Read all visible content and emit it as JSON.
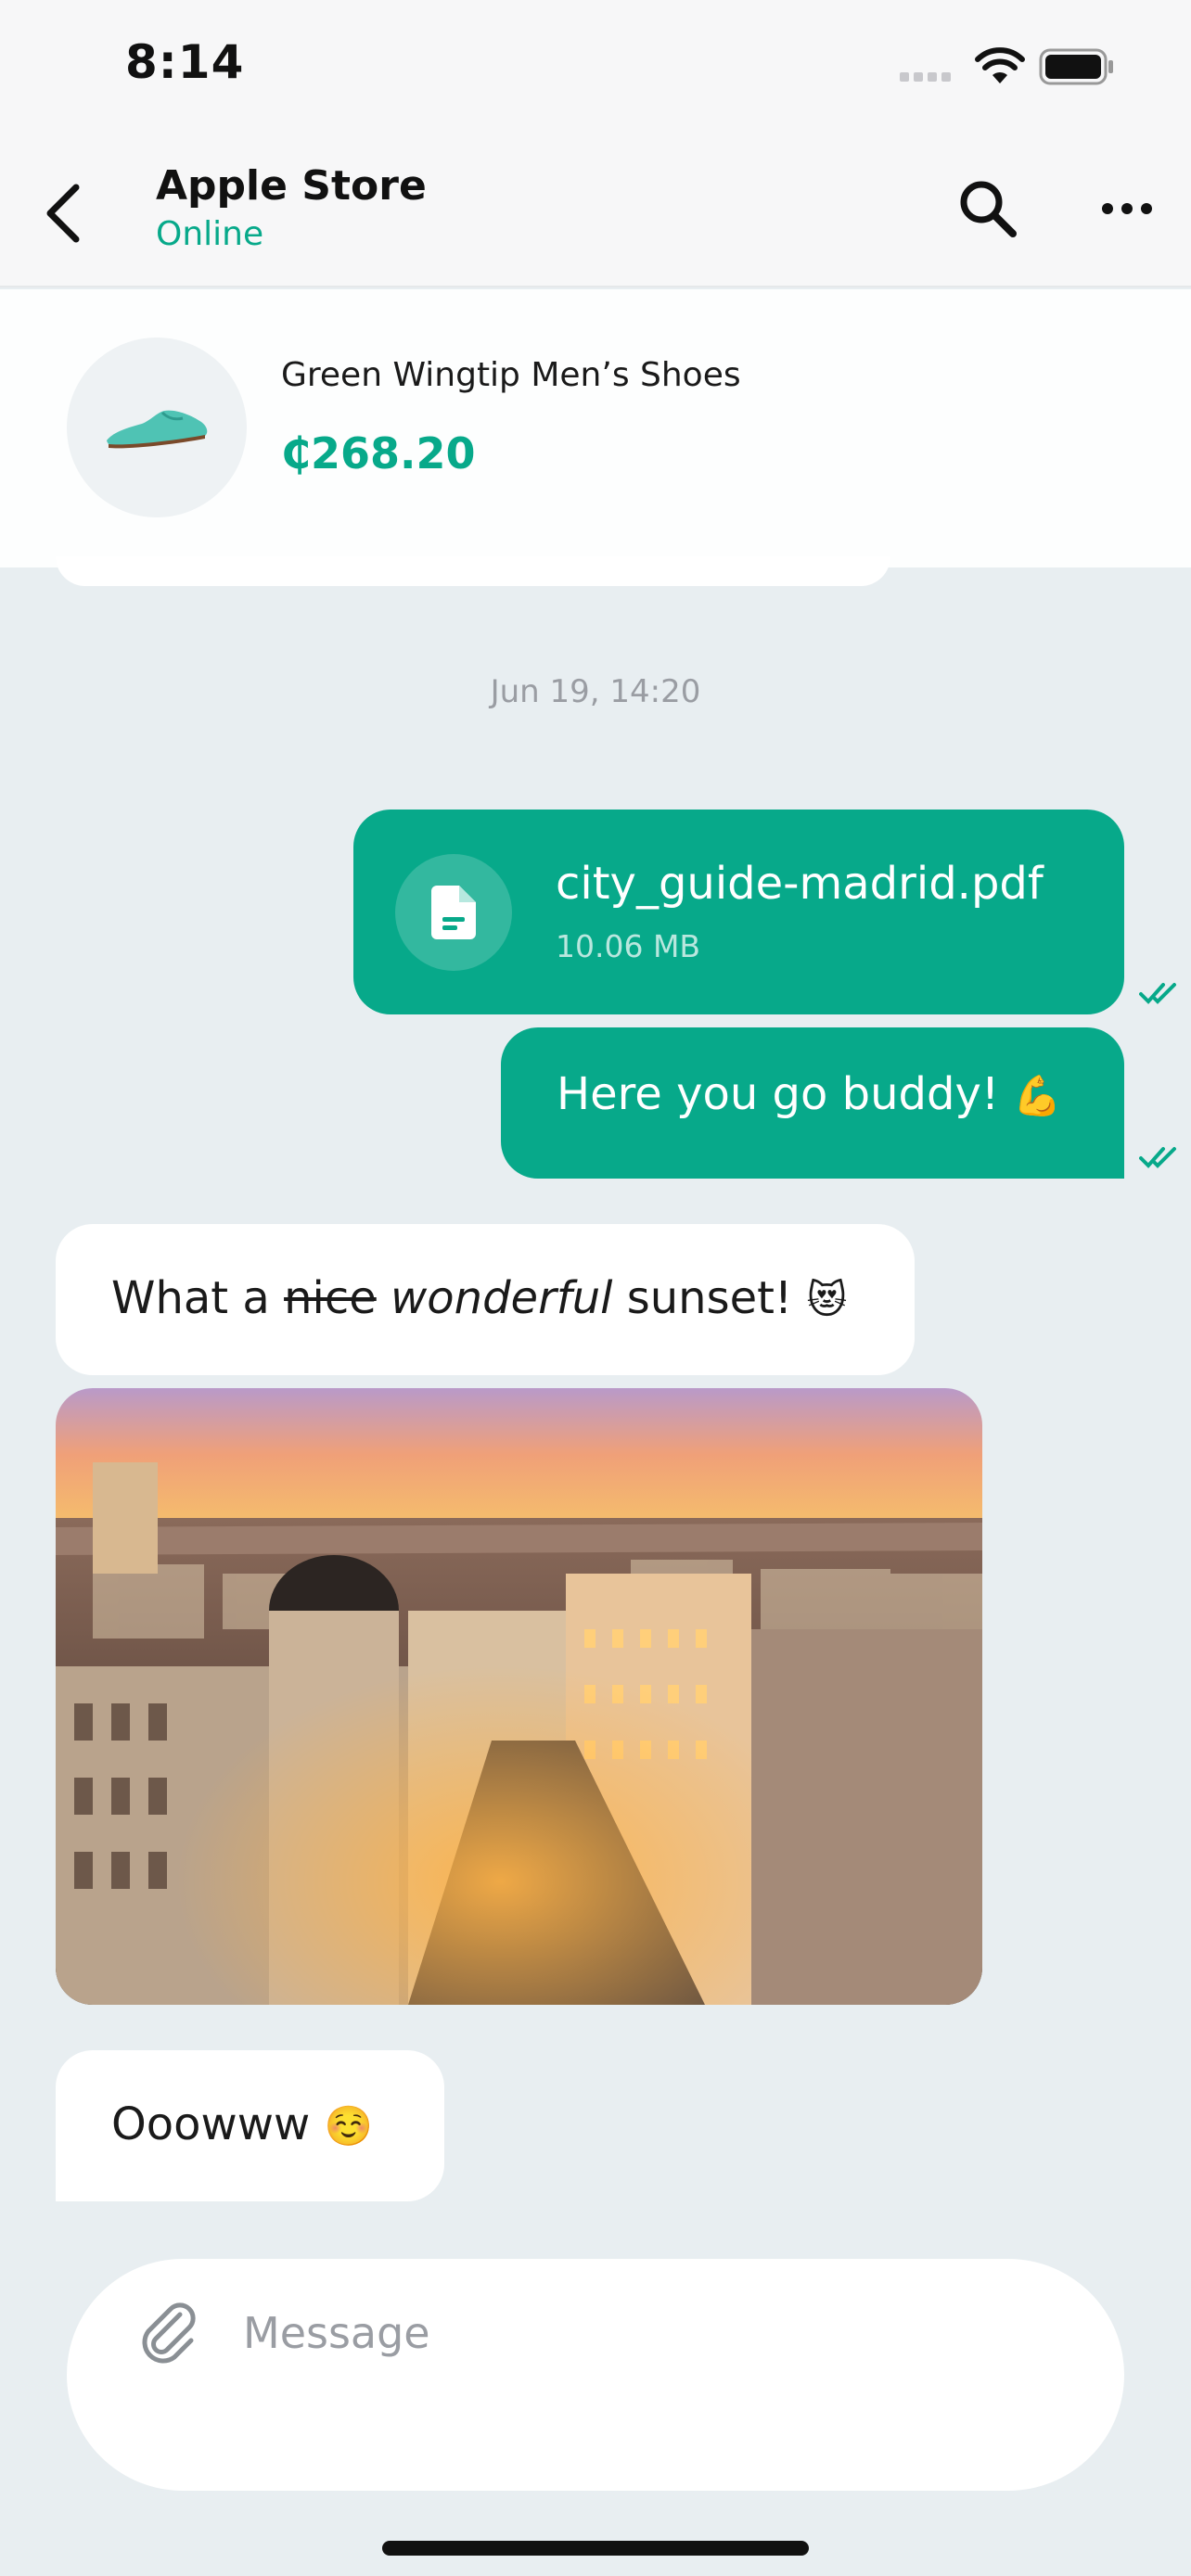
{
  "status_bar": {
    "time": "8:14"
  },
  "header": {
    "title": "Apple Store",
    "status": "Online"
  },
  "product": {
    "name": "Green Wingtip Men’s Shoes",
    "price": "₵268.20"
  },
  "date_separator": "Jun 19, 14:20",
  "messages": {
    "file": {
      "name": "city_guide-madrid.pdf",
      "size": "10.06 MB"
    },
    "outgoing_text": {
      "text": "Here you go buddy!",
      "emoji": "💪"
    },
    "incoming_1": {
      "part1": "What a",
      "struck": "nice",
      "italic": "wonderful",
      "part2": "sunset!",
      "emoji": "😻"
    },
    "incoming_2": {
      "text": "Ooowww",
      "emoji": "☺️"
    }
  },
  "composer": {
    "placeholder": "Message"
  },
  "colors": {
    "accent": "#07a98a",
    "background": "#e8eef1",
    "bubble_incoming": "#ffffff"
  },
  "icons": [
    "back-chevron-icon",
    "search-icon",
    "more-icon",
    "file-icon",
    "double-check-icon",
    "paperclip-icon"
  ]
}
